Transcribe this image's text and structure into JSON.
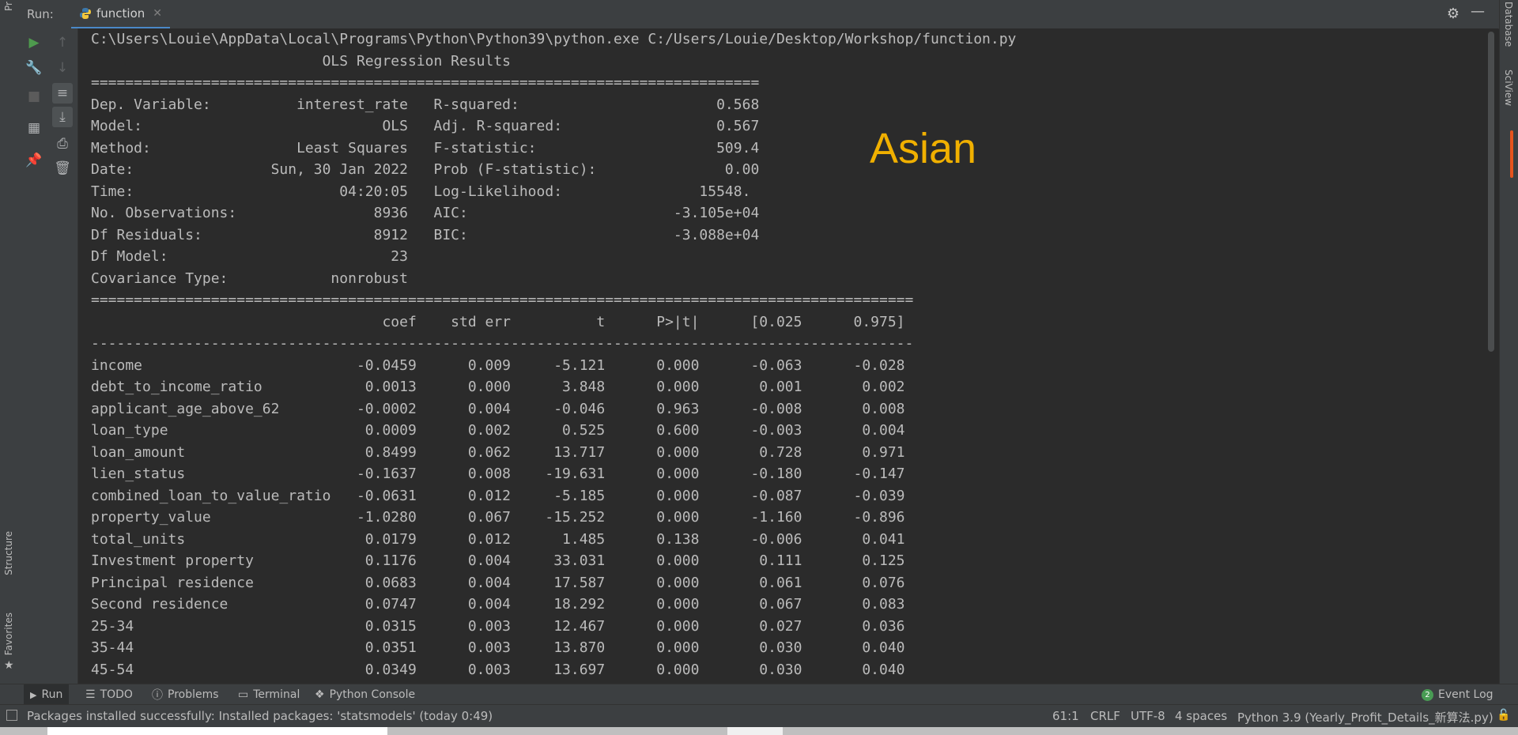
{
  "left_strip": {
    "project_label": "Pr",
    "structure_label": "Structure",
    "favorites_label": "Favorites"
  },
  "right_strip": {
    "database_label": "Database",
    "sciview_label": "SciView"
  },
  "run_panel": {
    "run_label": "Run:",
    "tab_label": "function",
    "toolbar_icons": [
      "run-icon",
      "up-arrow-icon",
      "wrench-icon",
      "down-arrow-icon",
      "stop-icon",
      "soft-wrap-icon",
      "layout-icon",
      "scroll-to-end-icon",
      "pin-icon",
      "print-icon",
      "trash-icon"
    ]
  },
  "console": {
    "command": "C:\\Users\\Louie\\AppData\\Local\\Programs\\Python\\Python39\\python.exe C:/Users/Louie/Desktop/Workshop/function.py",
    "lines": [
      "                           OLS Regression Results",
      "==============================================================================",
      "Dep. Variable:          interest_rate   R-squared:                       0.568",
      "Model:                            OLS   Adj. R-squared:                  0.567",
      "Method:                 Least Squares   F-statistic:                     509.4",
      "Date:                Sun, 30 Jan 2022   Prob (F-statistic):               0.00",
      "Time:                        04:20:05   Log-Likelihood:                15548.",
      "No. Observations:                8936   AIC:                        -3.105e+04",
      "Df Residuals:                    8912   BIC:                        -3.088e+04",
      "Df Model:                          23",
      "Covariance Type:            nonrobust",
      "================================================================================================",
      "                                  coef    std err          t      P>|t|      [0.025      0.975]",
      "------------------------------------------------------------------------------------------------",
      "income                         -0.0459      0.009     -5.121      0.000      -0.063      -0.028",
      "debt_to_income_ratio            0.0013      0.000      3.848      0.000       0.001       0.002",
      "applicant_age_above_62         -0.0002      0.004     -0.046      0.963      -0.008       0.008",
      "loan_type                       0.0009      0.002      0.525      0.600      -0.003       0.004",
      "loan_amount                     0.8499      0.062     13.717      0.000       0.728       0.971",
      "lien_status                    -0.1637      0.008    -19.631      0.000      -0.180      -0.147",
      "combined_loan_to_value_ratio   -0.0631      0.012     -5.185      0.000      -0.087      -0.039",
      "property_value                 -1.0280      0.067    -15.252      0.000      -1.160      -0.896",
      "total_units                     0.0179      0.012      1.485      0.138      -0.006       0.041",
      "Investment property             0.1176      0.004     33.031      0.000       0.111       0.125",
      "Principal residence             0.0683      0.004     17.587      0.000       0.061       0.076",
      "Second residence                0.0747      0.004     18.292      0.000       0.067       0.083",
      "25-34                           0.0315      0.003     12.467      0.000       0.027       0.036",
      "35-44                           0.0351      0.003     13.870      0.000       0.030       0.040",
      "45-54                           0.0349      0.003     13.697      0.000       0.030       0.040"
    ],
    "annotation": "Asian",
    "annotation_color": "#f0b000"
  },
  "bottom_tools": {
    "run": "Run",
    "todo": "TODO",
    "problems": "Problems",
    "terminal": "Terminal",
    "python_console": "Python Console",
    "event_log_count": "2",
    "event_log": "Event Log"
  },
  "status_bar": {
    "message": "Packages installed successfully: Installed packages: 'statsmodels' (today 0:49)",
    "position": "61:1",
    "line_sep": "CRLF",
    "encoding": "UTF-8",
    "indent": "4 spaces",
    "interpreter": "Python 3.9 (Yearly_Profit_Details_新算法.py)"
  }
}
